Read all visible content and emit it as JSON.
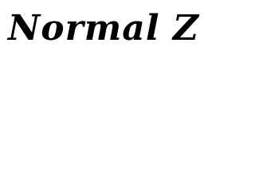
{
  "preview": {
    "text": "Normal Z"
  },
  "colors": {
    "background": "#ffffff",
    "text": "#000000"
  }
}
